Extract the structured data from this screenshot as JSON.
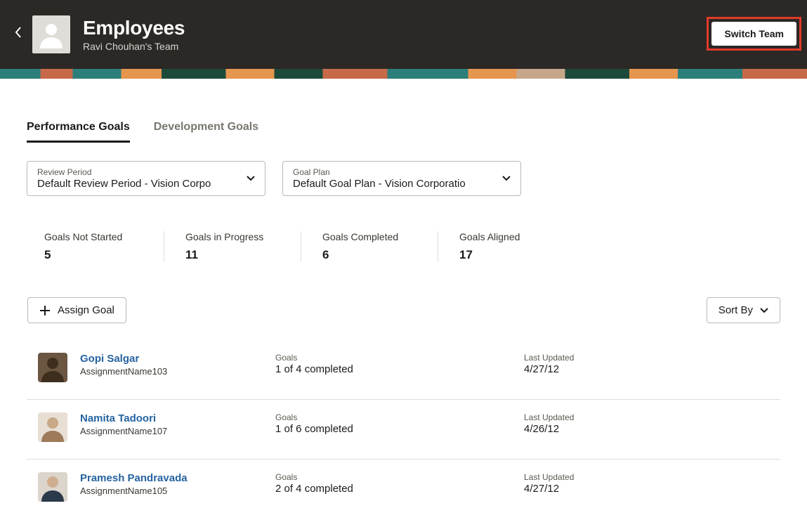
{
  "header": {
    "title": "Employees",
    "subtitle": "Ravi Chouhan's Team",
    "switch_team_label": "Switch Team"
  },
  "tabs": {
    "performance": "Performance Goals",
    "development": "Development Goals"
  },
  "filters": {
    "review_period": {
      "label": "Review Period",
      "value": "Default Review Period - Vision Corpo"
    },
    "goal_plan": {
      "label": "Goal Plan",
      "value": "Default Goal Plan - Vision Corporatio"
    }
  },
  "metrics": [
    {
      "label": "Goals Not Started",
      "value": "5"
    },
    {
      "label": "Goals in Progress",
      "value": "11"
    },
    {
      "label": "Goals Completed",
      "value": "6"
    },
    {
      "label": "Goals Aligned",
      "value": "17"
    }
  ],
  "toolbar": {
    "assign_goal_label": "Assign Goal",
    "sort_by_label": "Sort By"
  },
  "column_labels": {
    "goals": "Goals",
    "last_updated": "Last Updated"
  },
  "employees": [
    {
      "name": "Gopi Salgar",
      "assignment": "AssignmentName103",
      "goals": "1 of 4 completed",
      "updated": "4/27/12"
    },
    {
      "name": "Namita Tadoori",
      "assignment": "AssignmentName107",
      "goals": "1 of 6 completed",
      "updated": "4/26/12"
    },
    {
      "name": "Pramesh Pandravada",
      "assignment": "AssignmentName105",
      "goals": "2 of 4 completed",
      "updated": "4/27/12"
    }
  ]
}
